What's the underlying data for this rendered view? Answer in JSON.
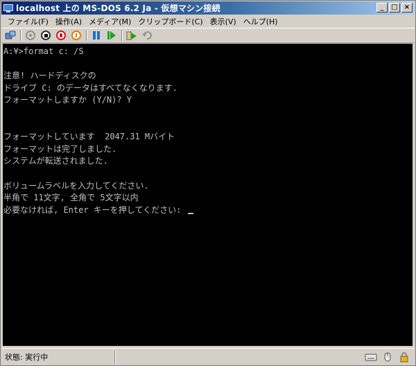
{
  "window": {
    "title": "localhost 上の MS-DOS 6.2 Ja - 仮想マシン接続",
    "minimize_glyph": "_",
    "maximize_glyph": "□",
    "close_glyph": "×"
  },
  "menubar": {
    "items": [
      {
        "label": "ファイル(F)"
      },
      {
        "label": "操作(A)"
      },
      {
        "label": "メディア(M)"
      },
      {
        "label": "クリップボード(C)"
      },
      {
        "label": "表示(V)"
      },
      {
        "label": "ヘルプ(H)"
      }
    ]
  },
  "toolbar": {
    "buttons": [
      {
        "icon": "ctrl-alt-del-icon"
      },
      {
        "icon": "start-icon"
      },
      {
        "icon": "turn-off-icon"
      },
      {
        "icon": "shut-down-icon"
      },
      {
        "icon": "power-icon"
      },
      {
        "icon": "pause-icon"
      },
      {
        "icon": "resume-icon"
      },
      {
        "icon": "snapshot-icon"
      },
      {
        "icon": "revert-icon"
      }
    ],
    "colors": {
      "red": "#d01818",
      "orange": "#e07a10",
      "blue": "#1e6fc8",
      "green": "#20a020",
      "gray": "#909090"
    }
  },
  "console": {
    "lines": [
      "A:¥>format c: /S",
      "",
      "注意! ハードディスクの",
      "ドライブ C: のデータはすべてなくなります.",
      "フォーマットしますか (Y/N)? Y",
      "",
      "",
      "フォーマットしています  2047.31 Mバイト",
      "フォーマットは完了しました.",
      "システムが転送されました.",
      "",
      "ボリュームラベルを入力してください.",
      "半角で 11文字, 全角で 5文字以内",
      "必要なければ, Enter キーを押してください: "
    ],
    "background": "#000000",
    "foreground": "#c0c0c0"
  },
  "statusbar": {
    "label": "状態: 実行中"
  }
}
